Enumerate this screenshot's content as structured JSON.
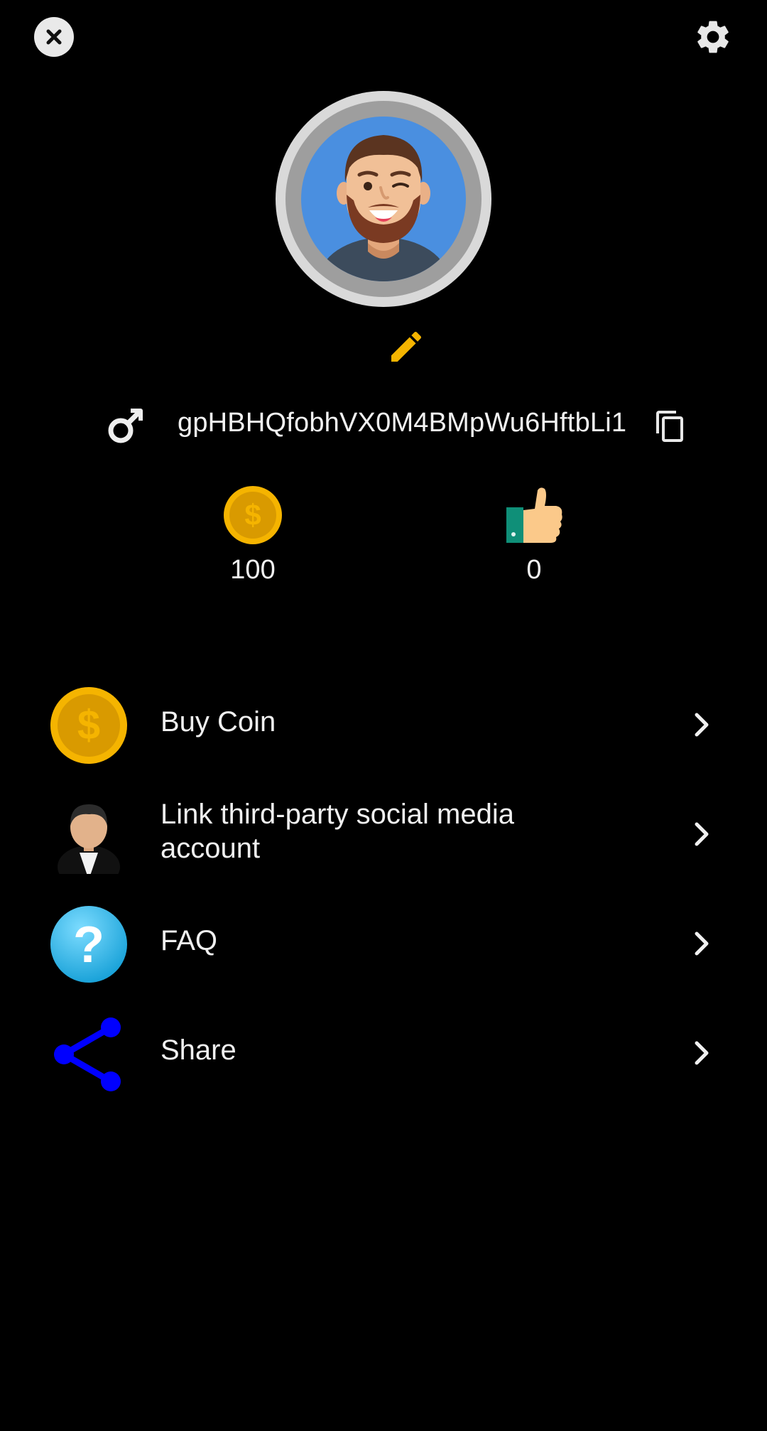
{
  "header": {
    "close_icon": "close-icon",
    "settings_icon": "gear-icon"
  },
  "profile": {
    "user_id": "gpHBHQfobhVX0M4BMpWu6HftbLi1",
    "coins": "100",
    "likes": "0"
  },
  "menu": {
    "items": [
      {
        "label": "Buy Coin",
        "icon": "coin-icon"
      },
      {
        "label": "Link third-party social media account",
        "icon": "person-icon"
      },
      {
        "label": "FAQ",
        "icon": "question-icon"
      },
      {
        "label": "Share",
        "icon": "share-icon"
      }
    ]
  },
  "colors": {
    "background": "#000000",
    "accent_gold": "#f5b400",
    "avatar_blue": "#4a8fe0",
    "share_blue": "#0000ff",
    "faq_blue": "#29b6e8"
  }
}
